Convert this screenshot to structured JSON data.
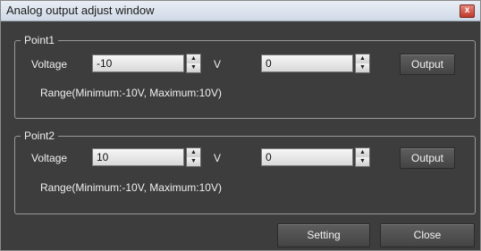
{
  "window": {
    "title": "Analog output adjust window",
    "close_glyph": "x"
  },
  "point1": {
    "legend": "Point1",
    "voltage_label": "Voltage",
    "voltage_value": "-10",
    "unit": "V",
    "output_value": "0",
    "output_button": "Output",
    "range": "Range(Minimum:-10V, Maximum:10V)"
  },
  "point2": {
    "legend": "Point2",
    "voltage_label": "Voltage",
    "voltage_value": "10",
    "unit": "V",
    "output_value": "0",
    "output_button": "Output",
    "range": "Range(Minimum:-10V, Maximum:10V)"
  },
  "footer": {
    "setting_button": "Setting",
    "close_button": "Close"
  },
  "icons": {
    "spin_up": "▲",
    "spin_down": "▼"
  },
  "colors": {
    "window_bg": "#3d3d3d",
    "title_bar": "#dfe6ef",
    "close_red": "#c0392b"
  }
}
